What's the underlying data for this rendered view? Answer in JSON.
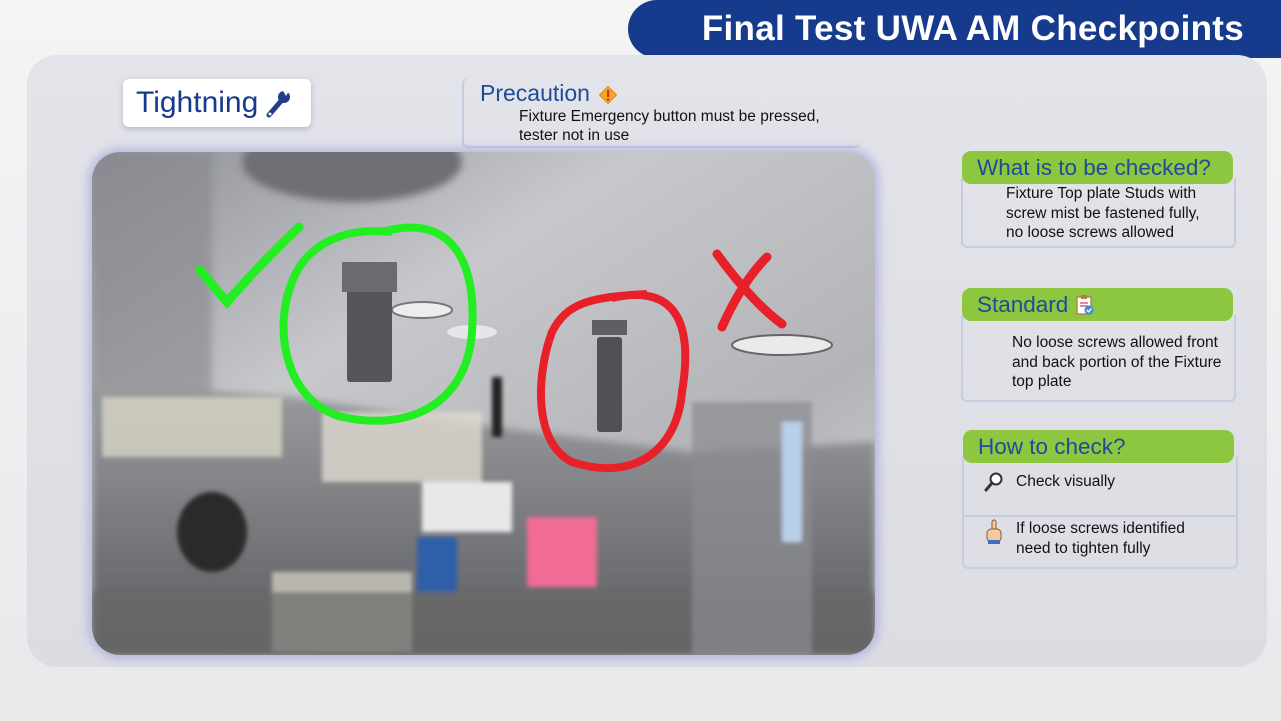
{
  "header": {
    "title": "Final Test UWA AM Checkpoints",
    "color": "#163a8c"
  },
  "tightning": {
    "label": "Tightning",
    "icon": "wrench-icon"
  },
  "precaution": {
    "title": "Precaution",
    "icon": "warning-icon",
    "text_line1": "Fixture Emergency button must be pressed,",
    "text_line2": "tester not in use"
  },
  "photo": {
    "description_icons": [
      "green-checkmark-icon",
      "red-x-icon"
    ],
    "good_color": "#22ee22",
    "bad_color": "#e8202a"
  },
  "what_check": {
    "title": "What is to be checked?",
    "line1": "Fixture Top plate Studs with",
    "line2": "screw mist be fastened fully,",
    "line3": "no loose screws allowed"
  },
  "standard": {
    "title": "Standard",
    "icon": "checklist-icon",
    "line1": "No loose screws allowed front",
    "line2": "and back portion of the Fixture",
    "line3": "top plate"
  },
  "how_check": {
    "title": "How to check?",
    "item1": {
      "icon": "magnifier-icon",
      "text": "Check visually"
    },
    "item2": {
      "icon": "hand-pointing-icon",
      "line1": "If loose screws identified",
      "line2": "need to tighten fully"
    }
  },
  "colors": {
    "accent_green": "#8dc63f",
    "title_blue": "#1f4b9a"
  }
}
